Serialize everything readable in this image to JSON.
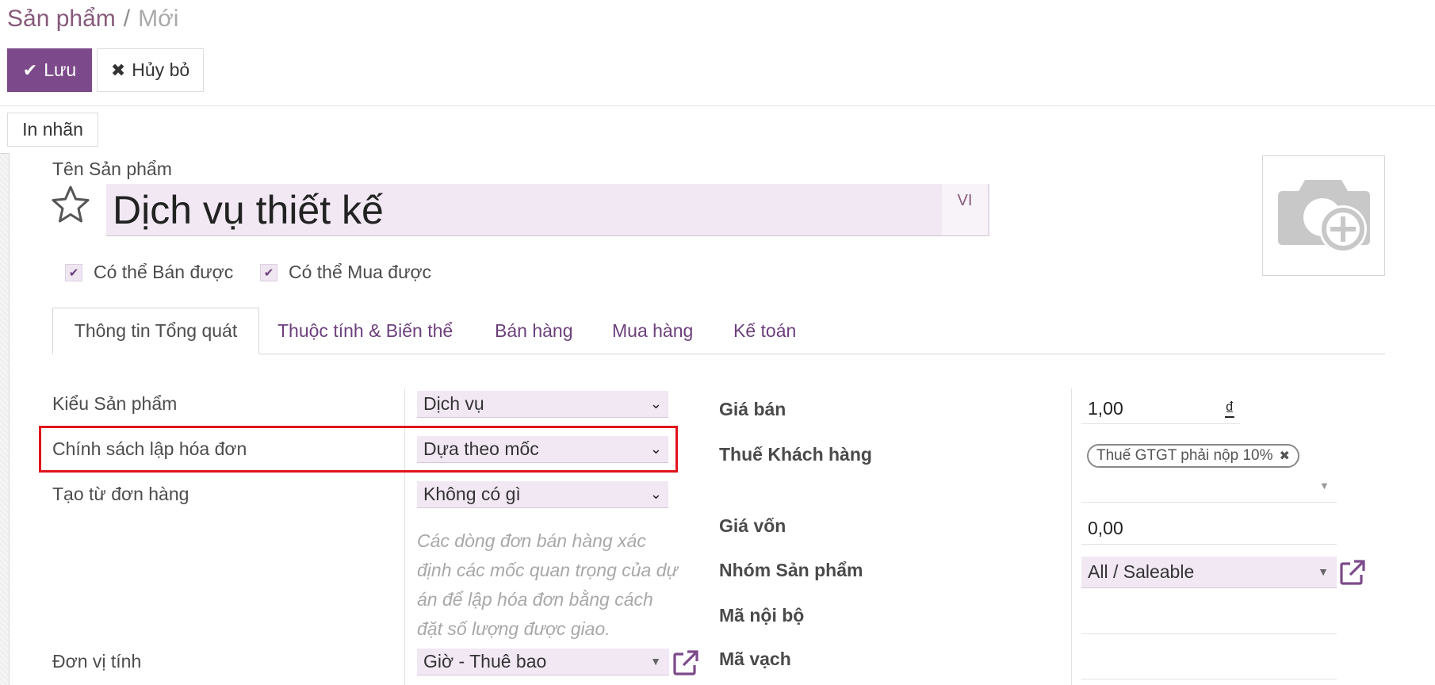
{
  "breadcrumb": {
    "parent": "Sản phẩm",
    "separator": "/",
    "current": "Mới"
  },
  "buttons": {
    "save": "Lưu",
    "discard": "Hủy bỏ",
    "print_label": "In nhãn"
  },
  "product": {
    "name_label": "Tên Sản phẩm",
    "name_value": "Dịch vụ thiết kế",
    "lang": "VI",
    "can_be_sold": "Có thể Bán được",
    "can_be_purchased": "Có thể Mua được"
  },
  "tabs": [
    {
      "label": "Thông tin Tổng quát",
      "active": true
    },
    {
      "label": "Thuộc tính & Biến thể"
    },
    {
      "label": "Bán hàng"
    },
    {
      "label": "Mua hàng"
    },
    {
      "label": "Kế toán"
    }
  ],
  "left_fields": {
    "product_type": {
      "label": "Kiểu Sản phẩm",
      "value": "Dịch vụ"
    },
    "invoice_policy": {
      "label": "Chính sách lập hóa đơn",
      "value": "Dựa theo mốc"
    },
    "create_on_order": {
      "label": "Tạo từ đơn hàng",
      "value": "Không có gì"
    },
    "help_text": "Các dòng đơn bán hàng xác định các mốc quan trọng của dự án để lập hóa đơn bằng cách đặt số lượng được giao.",
    "uom": {
      "label": "Đơn vị tính",
      "value": "Giờ - Thuê bao"
    }
  },
  "right_fields": {
    "sales_price": {
      "label": "Giá bán",
      "value": "1,00",
      "currency": "₫"
    },
    "customer_taxes": {
      "label": "Thuế Khách hàng",
      "tag": "Thuế GTGT phải nộp 10%"
    },
    "cost": {
      "label": "Giá vốn",
      "value": "0,00"
    },
    "category": {
      "label": "Nhóm Sản phẩm",
      "value": "All / Saleable"
    },
    "internal_ref": {
      "label": "Mã nội bộ",
      "value": ""
    },
    "barcode": {
      "label": "Mã vạch",
      "value": ""
    }
  },
  "colors": {
    "brand": "#7c4a8a",
    "input_bg": "#f1e8f4",
    "highlight": "#e0141b"
  },
  "icons": {
    "save": "check-icon",
    "discard": "close-icon",
    "favorite": "star-icon",
    "image": "camera-plus-icon",
    "external": "external-link-icon"
  }
}
